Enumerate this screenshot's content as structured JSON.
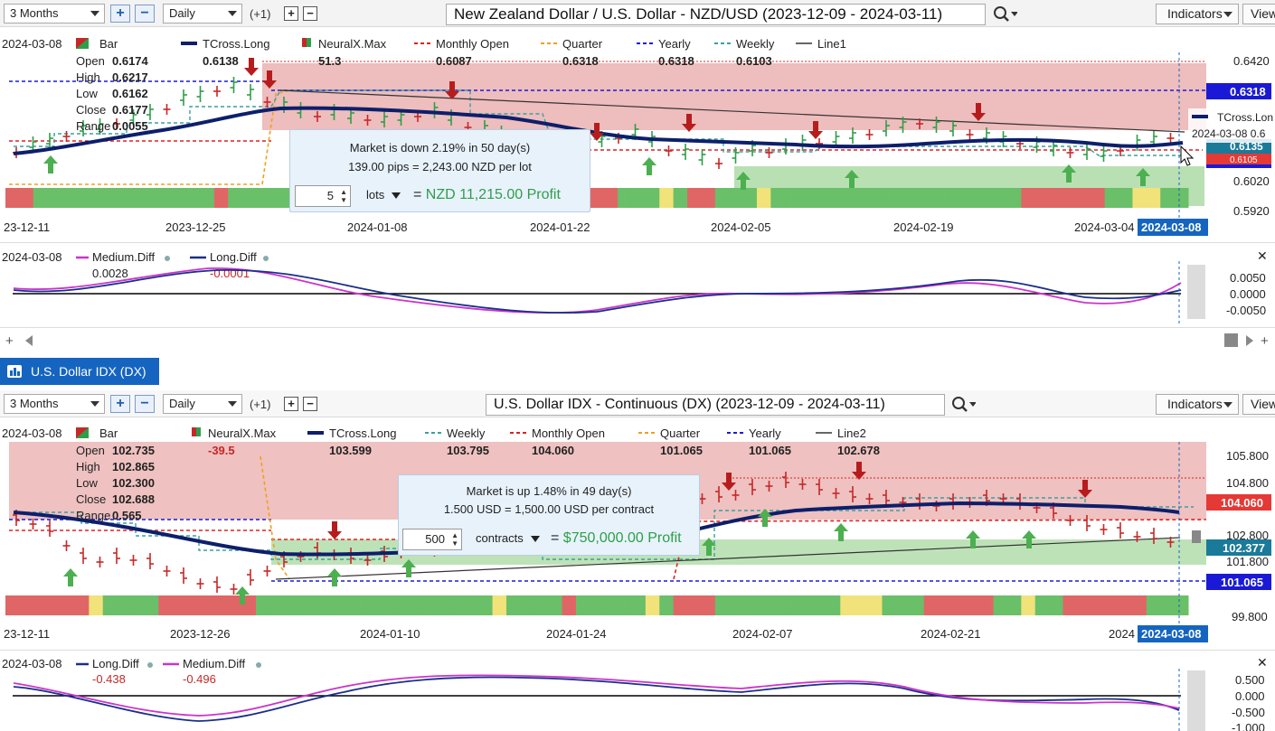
{
  "colors": {
    "accent_blue": "#1565c0",
    "yearly": "#1a1ad6",
    "monthly": "#e02020",
    "quarter": "#f0a020",
    "weekly": "#3aa0a0",
    "tcross": "#0d1f6b",
    "medium_diff": "#cc33cc",
    "long_diff": "#1a2f8a",
    "up_arrow": "#4caf50",
    "down_arrow": "#c62828",
    "profit_green": "#2e9e4a",
    "bg_red": "#e8a7a7",
    "bg_green": "#a8d8a0"
  },
  "top_chart": {
    "toolbar": {
      "range": "3 Months",
      "interval": "Daily",
      "offset": "(+1)",
      "title": "New Zealand Dollar / U.S. Dollar - NZD/USD (2023-12-09 - 2024-03-11)",
      "indicators": "Indicators",
      "view": "View"
    },
    "legend": {
      "date": "2024-03-08",
      "bar": "Bar",
      "items": [
        {
          "label": "TCross.Long",
          "value": "0.6138"
        },
        {
          "label": "NeuralX.Max",
          "value": "51.3"
        },
        {
          "label": "Monthly Open",
          "value": "0.6087"
        },
        {
          "label": "Quarter",
          "value": "0.6318"
        },
        {
          "label": "Yearly",
          "value": "0.6318"
        },
        {
          "label": "Weekly",
          "value": "0.6103"
        },
        {
          "label": "Line1",
          "value": ""
        }
      ],
      "ohlc": [
        {
          "k": "Open",
          "v": "0.6174"
        },
        {
          "k": "High",
          "v": "0.6217"
        },
        {
          "k": "Low",
          "v": "0.6162"
        },
        {
          "k": "Close",
          "v": "0.6177"
        },
        {
          "k": "Range",
          "v": "0.0055"
        }
      ]
    },
    "y_ticks": [
      "0.6420",
      "0.6020",
      "0.5920"
    ],
    "price_tags": [
      "0.6318",
      "0.6135",
      "0.6105"
    ],
    "x_ticks": [
      "23-12-11",
      "2023-12-25",
      "2024-01-08",
      "2024-01-22",
      "2024-02-05",
      "2024-02-19",
      "2024-03-04"
    ],
    "cursor_date": "2024-03-08",
    "crosshair_label": "TCross.Lon",
    "crosshair_date": "2024-03-08  0.6",
    "popup": {
      "line1": "Market is down 2.19% in 50 day(s)",
      "line2": "139.00 pips = 2,243.00 NZD per lot",
      "qty": "5",
      "unit": "lots",
      "equals": "=",
      "profit": "NZD 11,215.00 Profit"
    },
    "osc": {
      "date": "2024-03-08",
      "medium_label": "Medium.Diff",
      "medium_value": "0.0028",
      "long_label": "Long.Diff",
      "long_value": "-0.0001",
      "ticks": [
        "0.0050",
        "0.0000",
        "-0.0050"
      ]
    }
  },
  "tab": {
    "label": "U.S. Dollar IDX (DX)"
  },
  "bottom_chart": {
    "toolbar": {
      "range": "3 Months",
      "interval": "Daily",
      "offset": "(+1)",
      "title": "U.S. Dollar IDX - Continuous (DX) (2023-12-09 - 2024-03-11)",
      "indicators": "Indicators",
      "view": "View"
    },
    "legend": {
      "date": "2024-03-08",
      "bar": "Bar",
      "items": [
        {
          "label": "NeuralX.Max",
          "value": "-39.5"
        },
        {
          "label": "TCross.Long",
          "value": "103.599"
        },
        {
          "label": "Weekly",
          "value": "103.795"
        },
        {
          "label": "Monthly Open",
          "value": "104.060"
        },
        {
          "label": "Quarter",
          "value": "101.065"
        },
        {
          "label": "Yearly",
          "value": "101.065"
        },
        {
          "label": "Line2",
          "value": "102.678"
        }
      ],
      "ohlc": [
        {
          "k": "Open",
          "v": "102.735"
        },
        {
          "k": "High",
          "v": "102.865"
        },
        {
          "k": "Low",
          "v": "102.300"
        },
        {
          "k": "Close",
          "v": "102.688"
        },
        {
          "k": "Range",
          "v": "0.565"
        }
      ]
    },
    "y_ticks": [
      "105.800",
      "104.800",
      "102.800",
      "101.800",
      "99.800"
    ],
    "price_tags": [
      "104.060",
      "102.377",
      "101.065"
    ],
    "x_ticks": [
      "23-12-11",
      "2023-12-26",
      "2024-01-10",
      "2024-01-24",
      "2024-02-07",
      "2024-02-21",
      "2024"
    ],
    "cursor_date": "2024-03-08",
    "popup": {
      "line1": "Market is up 1.48% in 49 day(s)",
      "line2": "1.500 USD = 1,500.00 USD per contract",
      "qty": "500",
      "unit": "contracts",
      "equals": "=",
      "profit": "$750,000.00 Profit"
    },
    "osc": {
      "date": "2024-03-08",
      "long_label": "Long.Diff",
      "long_value": "-0.438",
      "medium_label": "Medium.Diff",
      "medium_value": "-0.496",
      "ticks": [
        "0.500",
        "0.000",
        "-0.500",
        "-1.000"
      ]
    }
  }
}
